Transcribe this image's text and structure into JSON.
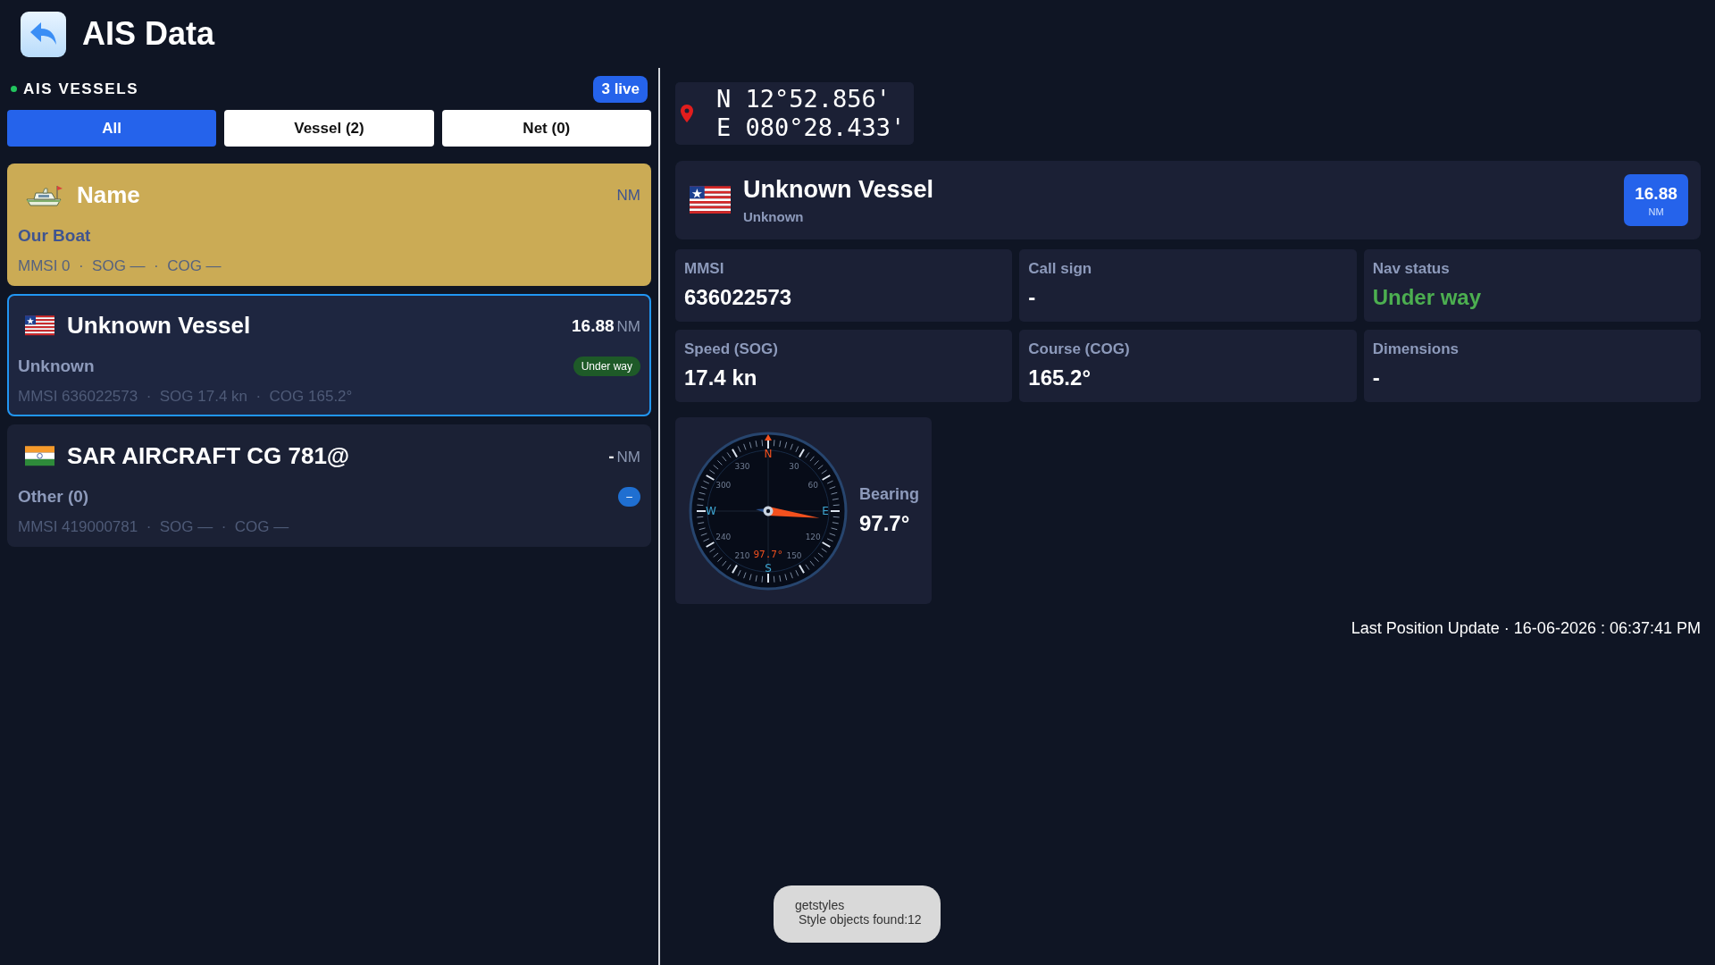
{
  "header": {
    "title": "AIS Data"
  },
  "vessel_list": {
    "title": "AIS VESSELS",
    "live_badge": "3 live",
    "tabs": [
      {
        "label": "All",
        "selected": true
      },
      {
        "label": "Vessel (2)",
        "selected": false
      },
      {
        "label": "Net (0)",
        "selected": false
      }
    ],
    "cards": [
      {
        "kind": "own",
        "name": "Name",
        "unit": "NM",
        "subtitle": "Our Boat",
        "details": "MMSI 0  ·  SOG —  ·  COG —",
        "selected": false
      },
      {
        "kind": "target",
        "name": "Unknown Vessel",
        "distance": "16.88",
        "unit": "NM",
        "subtitle": "Unknown",
        "status": {
          "label": "Under way",
          "color": "#1e5a28"
        },
        "details": "MMSI 636022573  ·  SOG 17.4 kn  ·  COG 165.2°",
        "selected": true
      },
      {
        "kind": "target",
        "name": "SAR AIRCRAFT CG 781@",
        "distance": "-",
        "unit": "NM",
        "subtitle": "Other (0)",
        "status": {
          "label": "–",
          "color": "#1f6fd1"
        },
        "details": "MMSI 419000781  ·  SOG —  ·  COG —",
        "selected": false
      }
    ]
  },
  "detail": {
    "position": {
      "lat": "N 12°52.856'",
      "lon": "E 080°28.433'"
    },
    "vessel": {
      "name": "Unknown Vessel",
      "subtitle": "Unknown",
      "distance": "16.88",
      "unit": "NM"
    },
    "fields": [
      {
        "label": "MMSI",
        "value": "636022573",
        "highlight": false
      },
      {
        "label": "Call sign",
        "value": "-",
        "highlight": false
      },
      {
        "label": "Nav status",
        "value": "Under way",
        "highlight": true
      },
      {
        "label": "Speed (SOG)",
        "value": "17.4 kn",
        "highlight": false
      },
      {
        "label": "Course (COG)",
        "value": "165.2°",
        "highlight": false
      },
      {
        "label": "Dimensions",
        "value": "-",
        "highlight": false
      }
    ],
    "compass": {
      "dial_labels": [
        "N",
        "30",
        "60",
        "E",
        "120",
        "150",
        "S",
        "210",
        "240",
        "W",
        "300",
        "330"
      ],
      "needle_reading": "97.7°",
      "bearing_label": "Bearing",
      "bearing_value": "97.7°"
    },
    "last_update": "Last Position Update · 16-06-2026 : 06:37:41 PM"
  },
  "toast": {
    "lines": [
      "getstyles",
      " Style objects found:12"
    ]
  }
}
